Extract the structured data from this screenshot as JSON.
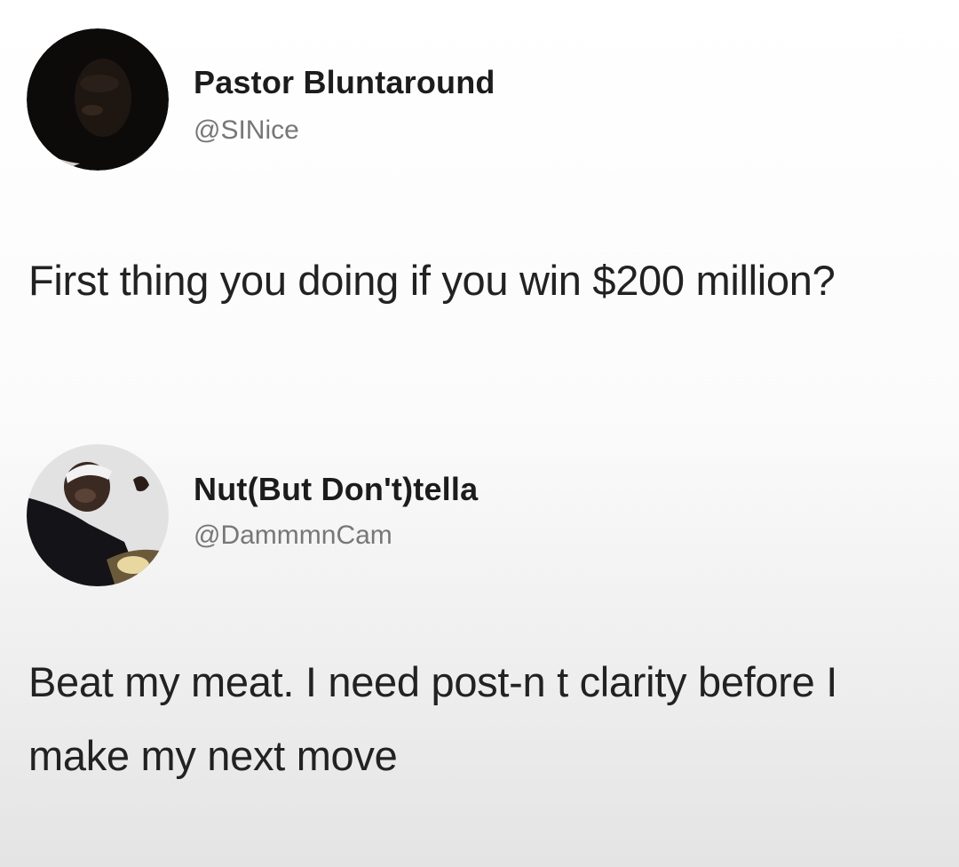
{
  "tweets": [
    {
      "display_name": "Pastor Bluntaround",
      "handle": "@SINice",
      "text": "First thing you doing if you win $200 million?",
      "avatar_icon": "profile-photo"
    },
    {
      "display_name": "Nut(But Don't)tella",
      "handle": "@DammmnCam",
      "text": "Beat my meat. I need post-n  t clarity before I make my next move",
      "avatar_icon": "profile-photo"
    }
  ],
  "colors": {
    "background_top": "#ffffff",
    "background_bottom": "#e4e4e4",
    "name": "#1c1c1c",
    "handle": "#777777",
    "body": "#222222"
  }
}
